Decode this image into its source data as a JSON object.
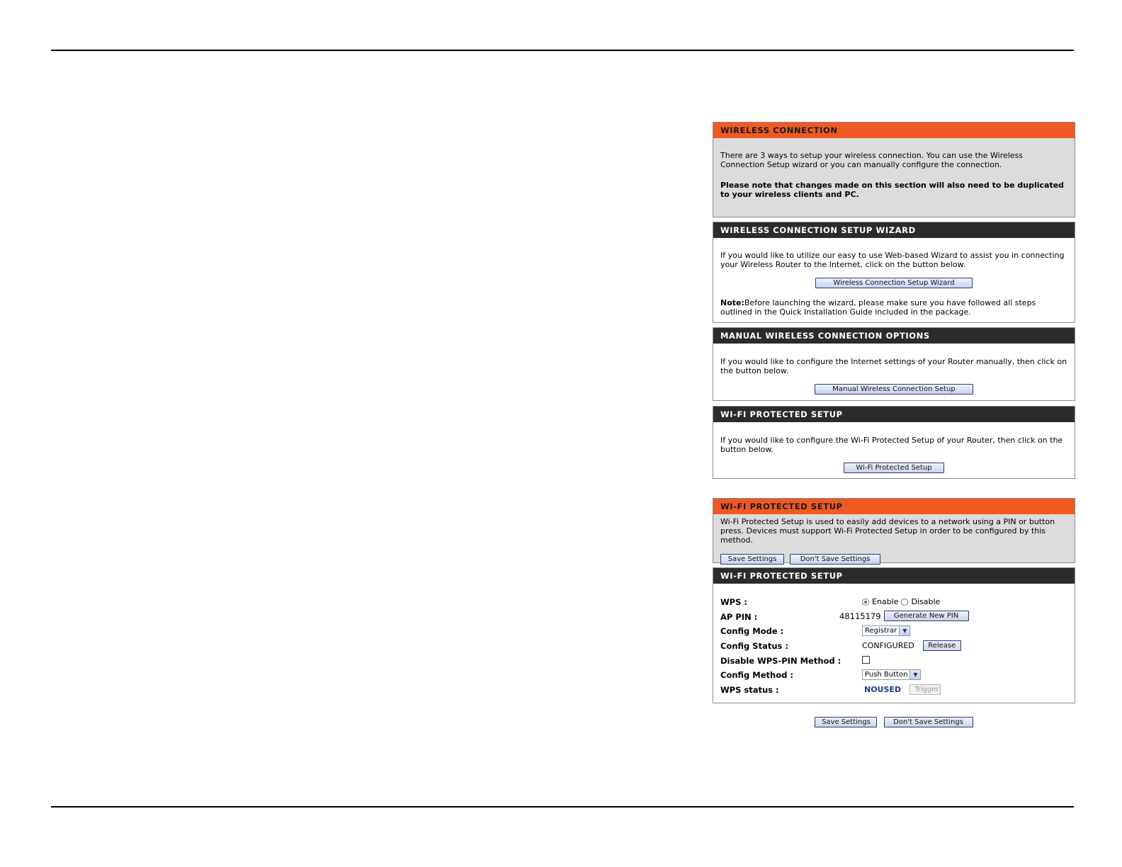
{
  "panels": {
    "wireless_connection": {
      "title": "WIRELESS CONNECTION",
      "intro": "There are 3 ways to setup your wireless connection. You can use the Wireless Connection Setup wizard or you can manually configure the connection.",
      "note": "Please note that changes made on this section will also need to be duplicated to your wireless clients and PC."
    },
    "setup_wizard": {
      "title": "WIRELESS CONNECTION SETUP WIZARD",
      "text": "If you would like to utilize our easy to use Web-based Wizard to assist you in connecting your Wireless Router to the Internet, click on the button below.",
      "button": "Wireless Connection Setup Wizard",
      "note_label": "Note:",
      "note_text": "Before launching the wizard, please make sure you have followed all steps outlined in the Quick Installation Guide included in the package."
    },
    "manual_options": {
      "title": "MANUAL WIRELESS CONNECTION OPTIONS",
      "text": "If you would like to configure the Internet settings of your Router manually, then click on the button below.",
      "button": "Manual Wireless Connection Setup"
    },
    "wifi_protected": {
      "title": "WI-FI PROTECTED SETUP",
      "text": "If you would like to configure the Wi-Fi Protected Setup of your Router, then click on the button below.",
      "button": "Wi-Fi Protected Setup"
    },
    "wps_intro": {
      "title": "WI-FI PROTECTED SETUP",
      "text": "Wi-Fi Protected Setup is used to easily add devices to a network using a PIN or button press. Devices must support Wi-Fi Protected Setup in order to be configured by this method.",
      "save": "Save Settings",
      "dont_save": "Don't Save Settings"
    },
    "wps_settings": {
      "title": "WI-FI PROTECTED SETUP",
      "wps_label": "WPS :",
      "enable": "Enable",
      "disable": "Disable",
      "ap_pin_label": "AP PIN :",
      "ap_pin_value": "48115179",
      "generate_pin": "Generate New PIN",
      "config_mode_label": "Config Mode :",
      "config_mode_value": "Registrar",
      "config_status_label": "Config Status :",
      "config_status_value": "CONFIGURED",
      "release": "Release",
      "disable_pin_label": "Disable WPS-PIN Method :",
      "config_method_label": "Config Method :",
      "config_method_value": "Push Button",
      "wps_status_label": "WPS status :",
      "wps_status_value": "NOUSED",
      "trigger": "Trigger"
    }
  },
  "footer_buttons": {
    "save": "Save Settings",
    "dont_save": "Don't Save Settings"
  }
}
